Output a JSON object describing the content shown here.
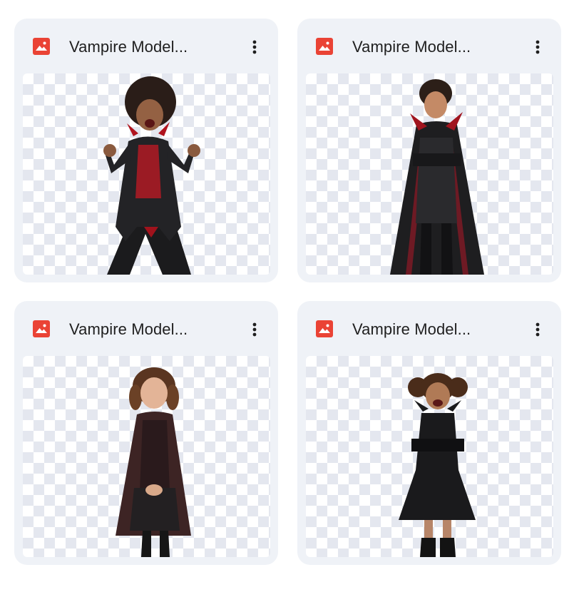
{
  "files": [
    {
      "title": "Vampire Model...",
      "icon": "image-file-icon",
      "menu_icon": "more-vert-icon"
    },
    {
      "title": "Vampire Model...",
      "icon": "image-file-icon",
      "menu_icon": "more-vert-icon"
    },
    {
      "title": "Vampire Model...",
      "icon": "image-file-icon",
      "menu_icon": "more-vert-icon"
    },
    {
      "title": "Vampire Model...",
      "icon": "image-file-icon",
      "menu_icon": "more-vert-icon"
    }
  ],
  "colors": {
    "card_background": "#eff2f7",
    "image_icon": "#ea4335",
    "title_text": "#1f1f1f",
    "checker": "#e4e7ef"
  }
}
